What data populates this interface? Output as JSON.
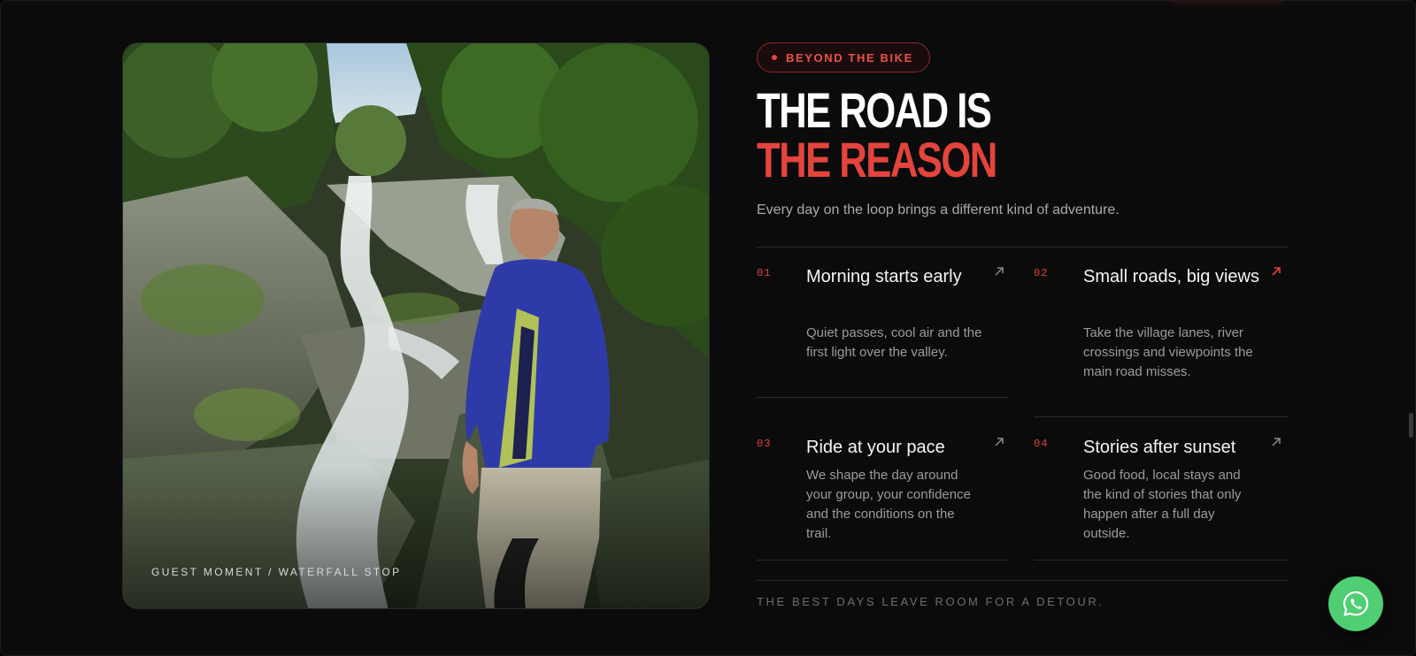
{
  "photo": {
    "caption": "GUEST MOMENT / WATERFALL STOP"
  },
  "eyebrow": {
    "label": "BEYOND THE BIKE"
  },
  "headline": {
    "line1": "THE ROAD IS",
    "line2": "THE REASON"
  },
  "lead": "Every day on the loop brings a different kind of adventure.",
  "features": [
    {
      "num": "01",
      "title": "Morning starts early",
      "desc": "Quiet passes, cool air and the first light over the valley.",
      "arrow_active": false
    },
    {
      "num": "02",
      "title": "Small roads, big views",
      "desc": "Take the village lanes, river crossings and viewpoints the main road misses.",
      "arrow_active": true
    },
    {
      "num": "03",
      "title": "Ride at your pace",
      "desc": "We shape the day around your group, your confidence and the conditions on the trail.",
      "arrow_active": false
    },
    {
      "num": "04",
      "title": "Stories after sunset",
      "desc": "Good food, local stays and the kind of stories that only happen after a full day outside.",
      "arrow_active": false
    }
  ],
  "footer_note": "THE BEST DAYS LEAVE ROOM FOR A DETOUR.",
  "colors": {
    "accent": "#e3443c",
    "background": "#0b0b0c",
    "whatsapp": "#4fce73"
  },
  "icons": {
    "feature_arrow": "arrow-up-right-icon",
    "chat": "whatsapp-icon"
  }
}
